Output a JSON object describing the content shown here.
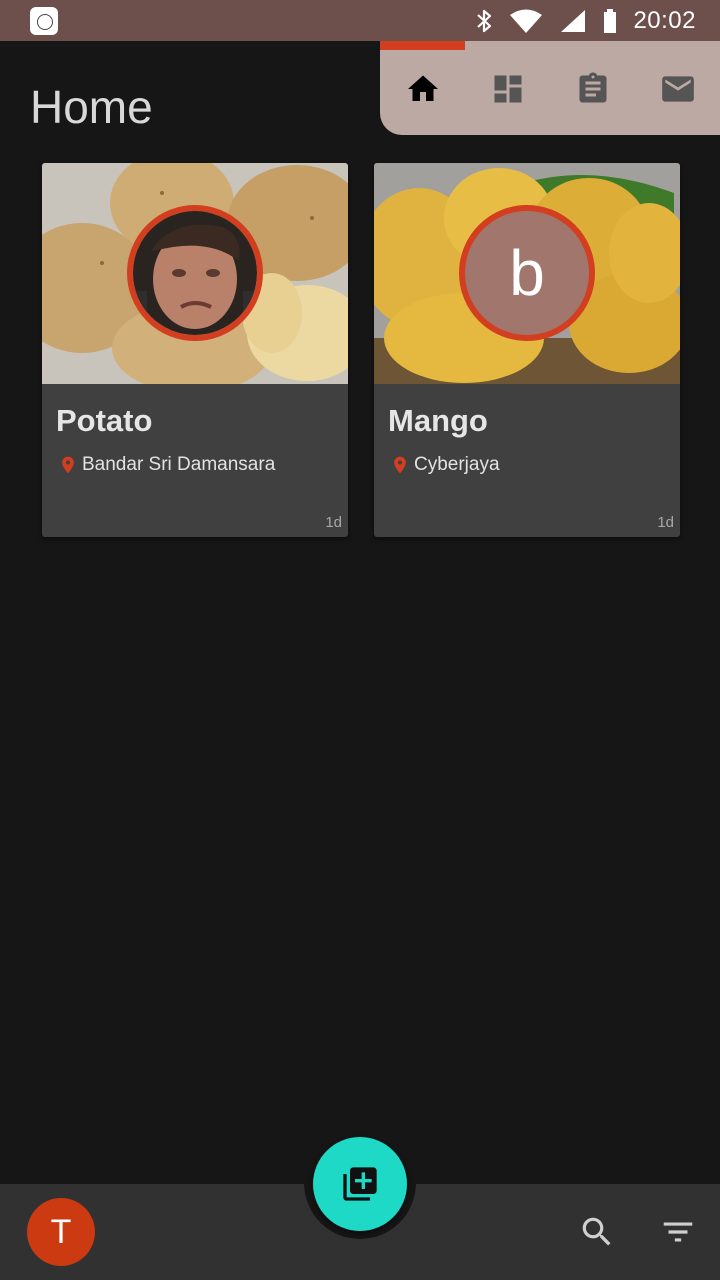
{
  "status_bar": {
    "time": "20:02",
    "icons": [
      "app-notification-icon",
      "bluetooth-icon",
      "wifi-icon",
      "cellular-signal-icon",
      "battery-icon"
    ],
    "background": "#6d4f4c"
  },
  "page": {
    "title": "Home"
  },
  "tabs": {
    "items": [
      {
        "icon": "home-icon",
        "selected": true
      },
      {
        "icon": "dashboard-icon",
        "selected": false
      },
      {
        "icon": "clipboard-icon",
        "selected": false
      },
      {
        "icon": "mail-icon",
        "selected": false
      }
    ],
    "accent": "#d23e1f",
    "background": "#bca9a4"
  },
  "cards": [
    {
      "title": "Potato",
      "location": "Bandar Sri Damansara",
      "age": "1d",
      "avatar": "user-photo"
    },
    {
      "title": "Mango",
      "location": "Cyberjaya",
      "age": "1d",
      "avatar_letter": "b"
    }
  ],
  "bottom_bar": {
    "profile_initial": "T",
    "fab_icon": "add-to-library-icon",
    "actions": [
      "search-icon",
      "filter-icon"
    ]
  },
  "colors": {
    "accent": "#d23e1f",
    "fab": "#1ed9c6",
    "card": "#404040",
    "background": "#161616"
  }
}
